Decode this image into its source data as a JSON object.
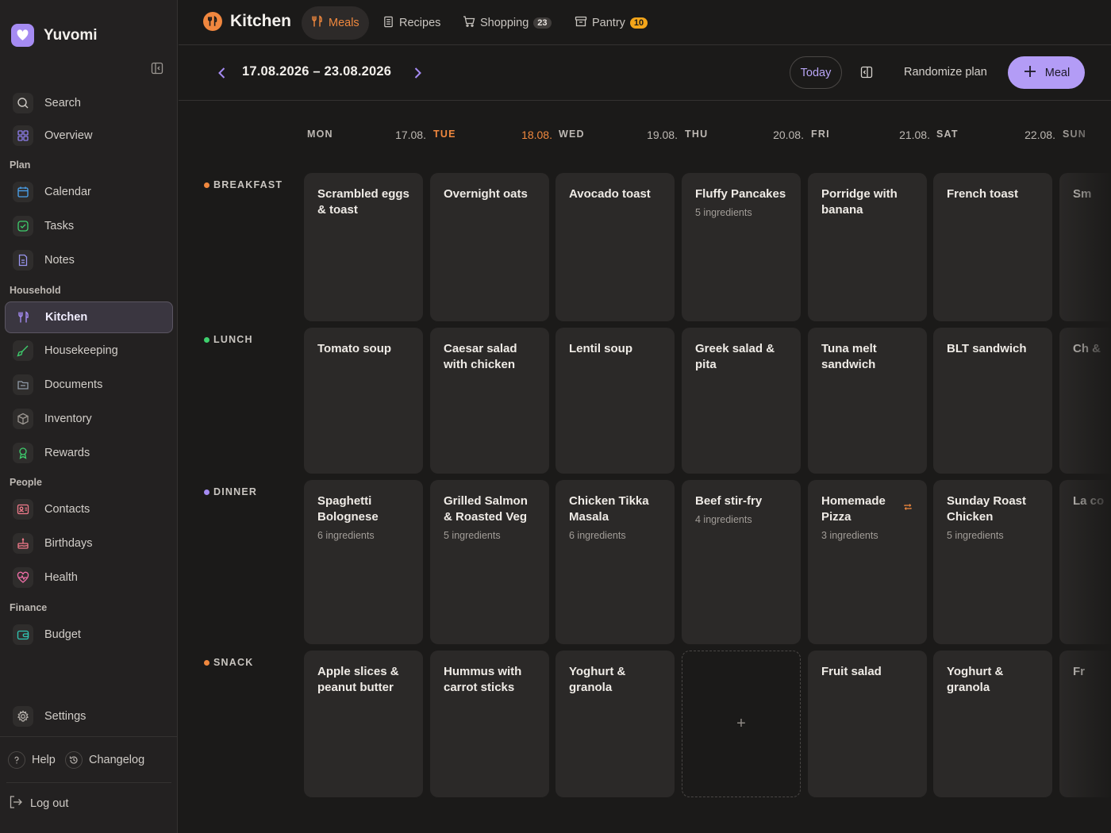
{
  "app": {
    "name": "Yuvomi"
  },
  "sidebar": {
    "items_top": [
      {
        "label": "Search",
        "icon": "search-icon"
      },
      {
        "label": "Overview",
        "icon": "grid-icon"
      }
    ],
    "sections": [
      {
        "label": "Plan",
        "items": [
          {
            "label": "Calendar",
            "icon": "calendar-icon"
          },
          {
            "label": "Tasks",
            "icon": "check-square-icon"
          },
          {
            "label": "Notes",
            "icon": "note-icon"
          }
        ]
      },
      {
        "label": "Household",
        "items": [
          {
            "label": "Kitchen",
            "icon": "utensils-icon"
          },
          {
            "label": "Housekeeping",
            "icon": "broom-icon"
          },
          {
            "label": "Documents",
            "icon": "folder-icon"
          },
          {
            "label": "Inventory",
            "icon": "box-icon"
          },
          {
            "label": "Rewards",
            "icon": "award-icon"
          }
        ]
      },
      {
        "label": "People",
        "items": [
          {
            "label": "Contacts",
            "icon": "contact-card-icon"
          },
          {
            "label": "Birthdays",
            "icon": "cake-icon"
          },
          {
            "label": "Health",
            "icon": "heart-pulse-icon"
          }
        ]
      },
      {
        "label": "Finance",
        "items": [
          {
            "label": "Budget",
            "icon": "wallet-icon"
          }
        ]
      }
    ],
    "settings_label": "Settings",
    "help_label": "Help",
    "changelog_label": "Changelog",
    "logout_label": "Log out"
  },
  "header": {
    "title": "Kitchen",
    "tabs": [
      {
        "label": "Meals",
        "badge": ""
      },
      {
        "label": "Recipes",
        "badge": ""
      },
      {
        "label": "Shopping",
        "badge": "23"
      },
      {
        "label": "Pantry",
        "badge": "10"
      }
    ]
  },
  "toolbar": {
    "date_range": "17.08.2026 – 23.08.2026",
    "today_label": "Today",
    "randomize_label": "Randomize plan",
    "add_meal_label": "Meal"
  },
  "days": [
    {
      "name": "MON",
      "date": "17.08."
    },
    {
      "name": "TUE",
      "date": "18.08."
    },
    {
      "name": "WED",
      "date": "19.08."
    },
    {
      "name": "THU",
      "date": "20.08."
    },
    {
      "name": "FRI",
      "date": "21.08."
    },
    {
      "name": "SAT",
      "date": "22.08."
    },
    {
      "name": "SUN",
      "date": ""
    }
  ],
  "meal_rows": [
    {
      "label": "BREAKFAST",
      "color": "#f0883e",
      "meals": [
        {
          "title": "Scrambled eggs & toast",
          "sub": ""
        },
        {
          "title": "Overnight oats",
          "sub": ""
        },
        {
          "title": "Avocado toast",
          "sub": ""
        },
        {
          "title": "Fluffy Pancakes",
          "sub": "5 ingredients"
        },
        {
          "title": "Porridge with banana",
          "sub": ""
        },
        {
          "title": "French toast",
          "sub": ""
        },
        {
          "title": "Sm",
          "sub": ""
        }
      ]
    },
    {
      "label": "LUNCH",
      "color": "#3ecf6d",
      "meals": [
        {
          "title": "Tomato soup",
          "sub": ""
        },
        {
          "title": "Caesar salad with chicken",
          "sub": ""
        },
        {
          "title": "Lentil soup",
          "sub": ""
        },
        {
          "title": "Greek salad & pita",
          "sub": ""
        },
        {
          "title": "Tuna melt sandwich",
          "sub": ""
        },
        {
          "title": "BLT sandwich",
          "sub": ""
        },
        {
          "title": "Ch &",
          "sub": ""
        }
      ]
    },
    {
      "label": "DINNER",
      "color": "#a58bf2",
      "meals": [
        {
          "title": "Spaghetti Bolognese",
          "sub": "6 ingredients"
        },
        {
          "title": "Grilled Salmon & Roasted Veg",
          "sub": "5 ingredients"
        },
        {
          "title": "Chicken Tikka Masala",
          "sub": "6 ingredients"
        },
        {
          "title": "Beef stir-fry",
          "sub": "4 ingredients"
        },
        {
          "title": "Homemade Pizza",
          "sub": "3 ingredients",
          "repeat": true
        },
        {
          "title": "Sunday Roast Chicken",
          "sub": "5 ingredients"
        },
        {
          "title": "La co",
          "sub": ""
        }
      ]
    },
    {
      "label": "SNACK",
      "color": "#f0883e",
      "meals": [
        {
          "title": "Apple slices & peanut butter",
          "sub": ""
        },
        {
          "title": "Hummus with carrot sticks",
          "sub": ""
        },
        {
          "title": "Yoghurt & granola",
          "sub": ""
        },
        {
          "title": "",
          "sub": "",
          "empty": true,
          "plus": "+"
        },
        {
          "title": "Fruit salad",
          "sub": ""
        },
        {
          "title": "Yoghurt & granola",
          "sub": ""
        },
        {
          "title": "Fr",
          "sub": ""
        }
      ]
    }
  ],
  "colors": {
    "accent": "#b39cf6",
    "today": "#f0883e"
  }
}
